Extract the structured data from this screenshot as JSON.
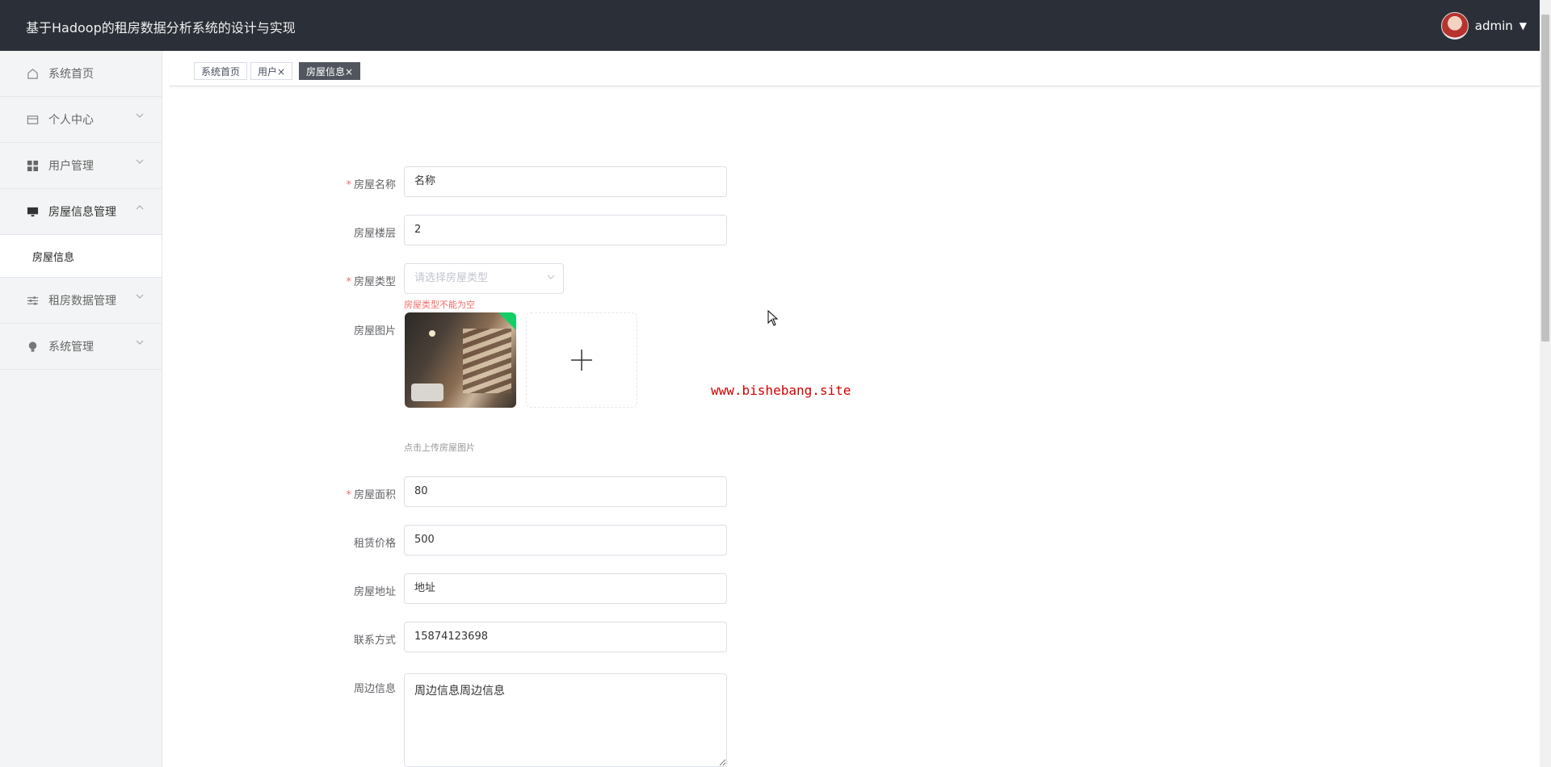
{
  "header": {
    "title": "基于Hadoop的租房数据分析系统的设计与实现",
    "user_name": "admin",
    "caret": "▼"
  },
  "sidebar": {
    "items": [
      {
        "label": "系统首页",
        "icon": "home-icon"
      },
      {
        "label": "个人中心",
        "icon": "wallet-icon"
      },
      {
        "label": "用户管理",
        "icon": "grid-icon"
      },
      {
        "label": "房屋信息管理",
        "icon": "monitor-icon"
      },
      {
        "label": "租房数据管理",
        "icon": "sliders-icon"
      },
      {
        "label": "系统管理",
        "icon": "bulb-icon"
      }
    ],
    "sub_items": [
      {
        "label": "房屋信息"
      }
    ]
  },
  "tabs": [
    {
      "label": "系统首页"
    },
    {
      "label": "用户×"
    },
    {
      "label": "房屋信息×"
    }
  ],
  "form": {
    "name": {
      "label": "房屋名称",
      "value": "名称",
      "required": true
    },
    "floor": {
      "label": "房屋楼层",
      "value": "2"
    },
    "type": {
      "label": "房屋类型",
      "placeholder": "请选择房屋类型",
      "error": "房屋类型不能为空",
      "required": true
    },
    "image": {
      "label": "房屋图片",
      "hint": "点击上传房屋图片",
      "plus": "+"
    },
    "area": {
      "label": "房屋面积",
      "value": "80",
      "required": true
    },
    "price": {
      "label": "租赁价格",
      "value": "500"
    },
    "address": {
      "label": "房屋地址",
      "value": "地址"
    },
    "contact": {
      "label": "联系方式",
      "value": "15874123698"
    },
    "surroundings": {
      "label": "周边信息",
      "value": "周边信息周边信息"
    }
  },
  "watermark": "www.bishebang.site",
  "colors": {
    "header_bg": "#2b3038",
    "sidebar_bg": "#f3f4f5",
    "error": "#f56c6c",
    "success": "#13ce66",
    "watermark": "#d40000"
  }
}
